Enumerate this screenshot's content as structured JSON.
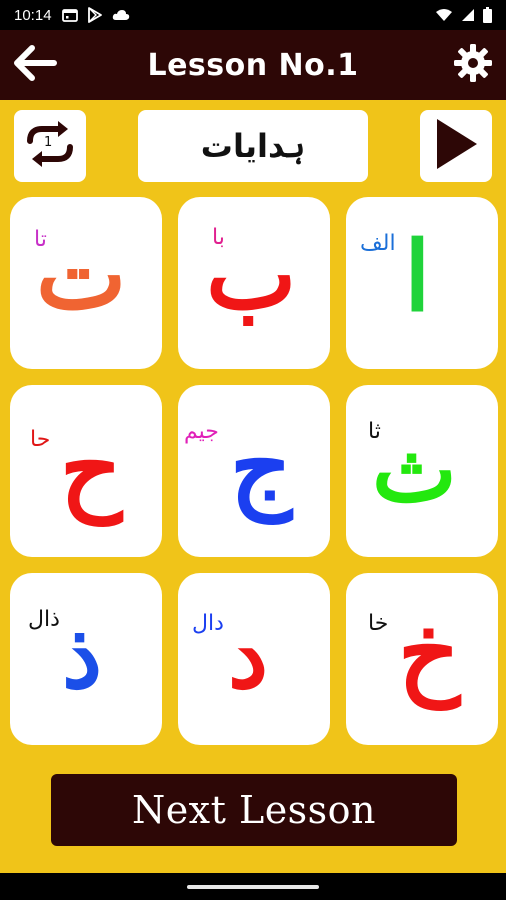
{
  "status_bar": {
    "time": "10:14",
    "icons": [
      "calendar-icon",
      "play-store-icon",
      "cloud-icon"
    ],
    "right_icons": [
      "wifi-icon",
      "signal-icon",
      "battery-icon"
    ]
  },
  "app_bar": {
    "title": "Lesson No.1",
    "back_icon": "arrow-left-icon",
    "settings_icon": "settings-gear-icon"
  },
  "controls": {
    "repeat_count": "1",
    "instructions_label": "ہدایات",
    "play_icon": "play-icon"
  },
  "cards": [
    {
      "letter": "ا",
      "name": "الف",
      "letter_color": "#1fd33a",
      "name_color": "#1b6fd8"
    },
    {
      "letter": "ب",
      "name": "با",
      "letter_color": "#f01616",
      "name_color": "#e0208f"
    },
    {
      "letter": "ت",
      "name": "تا",
      "letter_color": "#f06432",
      "name_color": "#c730c7"
    },
    {
      "letter": "ث",
      "name": "ثا",
      "letter_color": "#23e80e",
      "name_color": "#111111"
    },
    {
      "letter": "ج",
      "name": "جیم",
      "letter_color": "#1b3ff0",
      "name_color": "#e020b8"
    },
    {
      "letter": "ح",
      "name": "حا",
      "letter_color": "#f01616",
      "name_color": "#e01616"
    },
    {
      "letter": "خ",
      "name": "خا",
      "letter_color": "#f01616",
      "name_color": "#111111"
    },
    {
      "letter": "د",
      "name": "دال",
      "letter_color": "#f01616",
      "name_color": "#1b3ff0"
    },
    {
      "letter": "ذ",
      "name": "ذال",
      "letter_color": "#1b4fe8",
      "name_color": "#111111"
    }
  ],
  "next_button_label": "Next Lesson",
  "colors": {
    "background": "#f0c419",
    "app_bar": "#2d0706",
    "next_button": "#2d0706"
  }
}
